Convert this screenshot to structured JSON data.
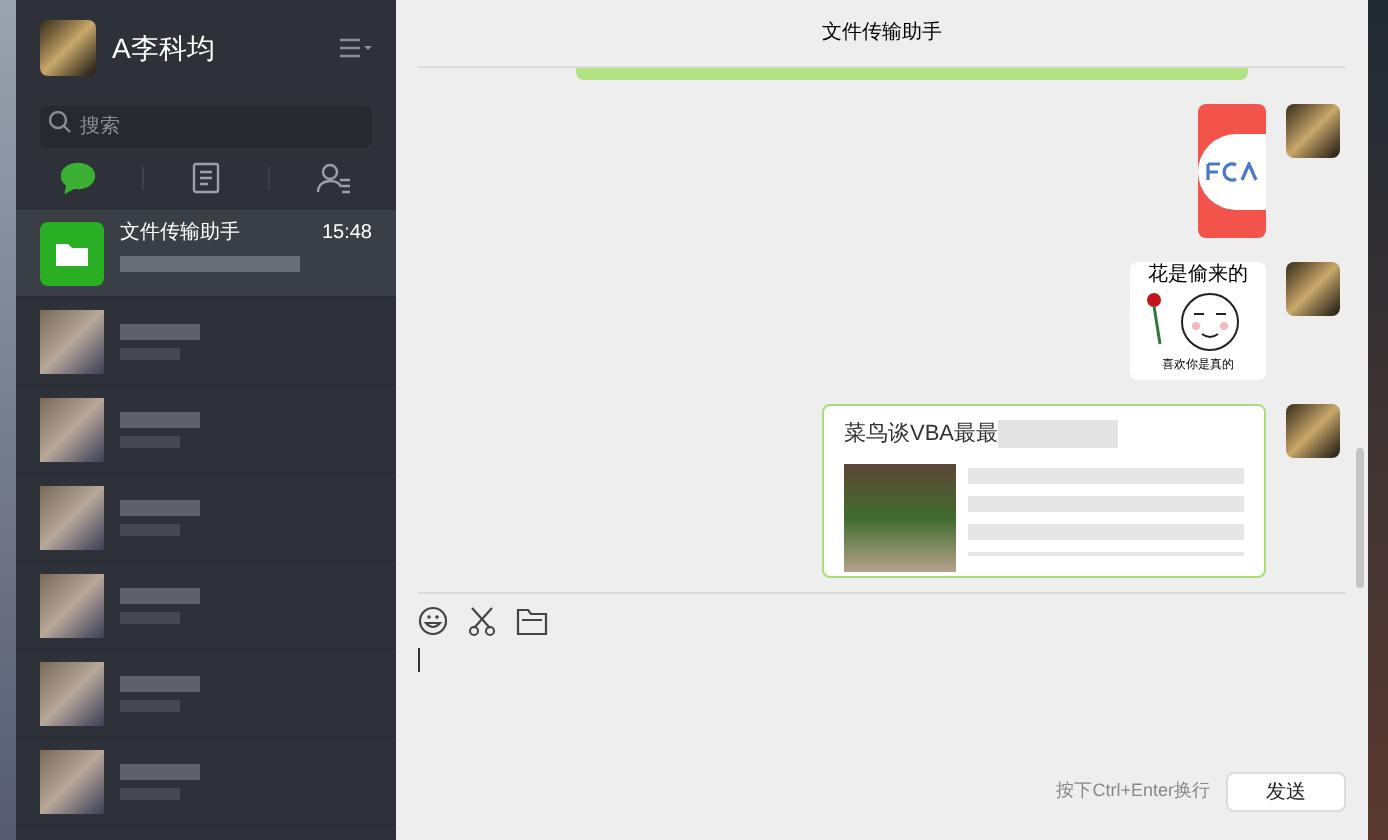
{
  "window": {
    "title": "文件传输助手"
  },
  "sidebar": {
    "user_name": "A李科均",
    "search": {
      "placeholder": "搜索"
    },
    "tabs": [
      {
        "kind": "chat",
        "selected": true
      },
      {
        "kind": "contacts-card",
        "selected": false
      },
      {
        "kind": "people",
        "selected": false
      }
    ],
    "chats": [
      {
        "name": "文件传输助手",
        "time": "15:48",
        "selected": true
      },
      {
        "selected": false
      },
      {
        "selected": false
      },
      {
        "selected": false
      },
      {
        "selected": false
      },
      {
        "selected": false
      },
      {
        "selected": false
      }
    ]
  },
  "messages": [
    {
      "kind": "image"
    },
    {
      "kind": "sticker",
      "caption": "花是偷来的",
      "subcaption": "喜欢你是真的"
    },
    {
      "kind": "link",
      "title": "菜鸟谈VBA最最"
    }
  ],
  "composer": {
    "hint": "按下Ctrl+Enter换行",
    "send": "发送"
  }
}
